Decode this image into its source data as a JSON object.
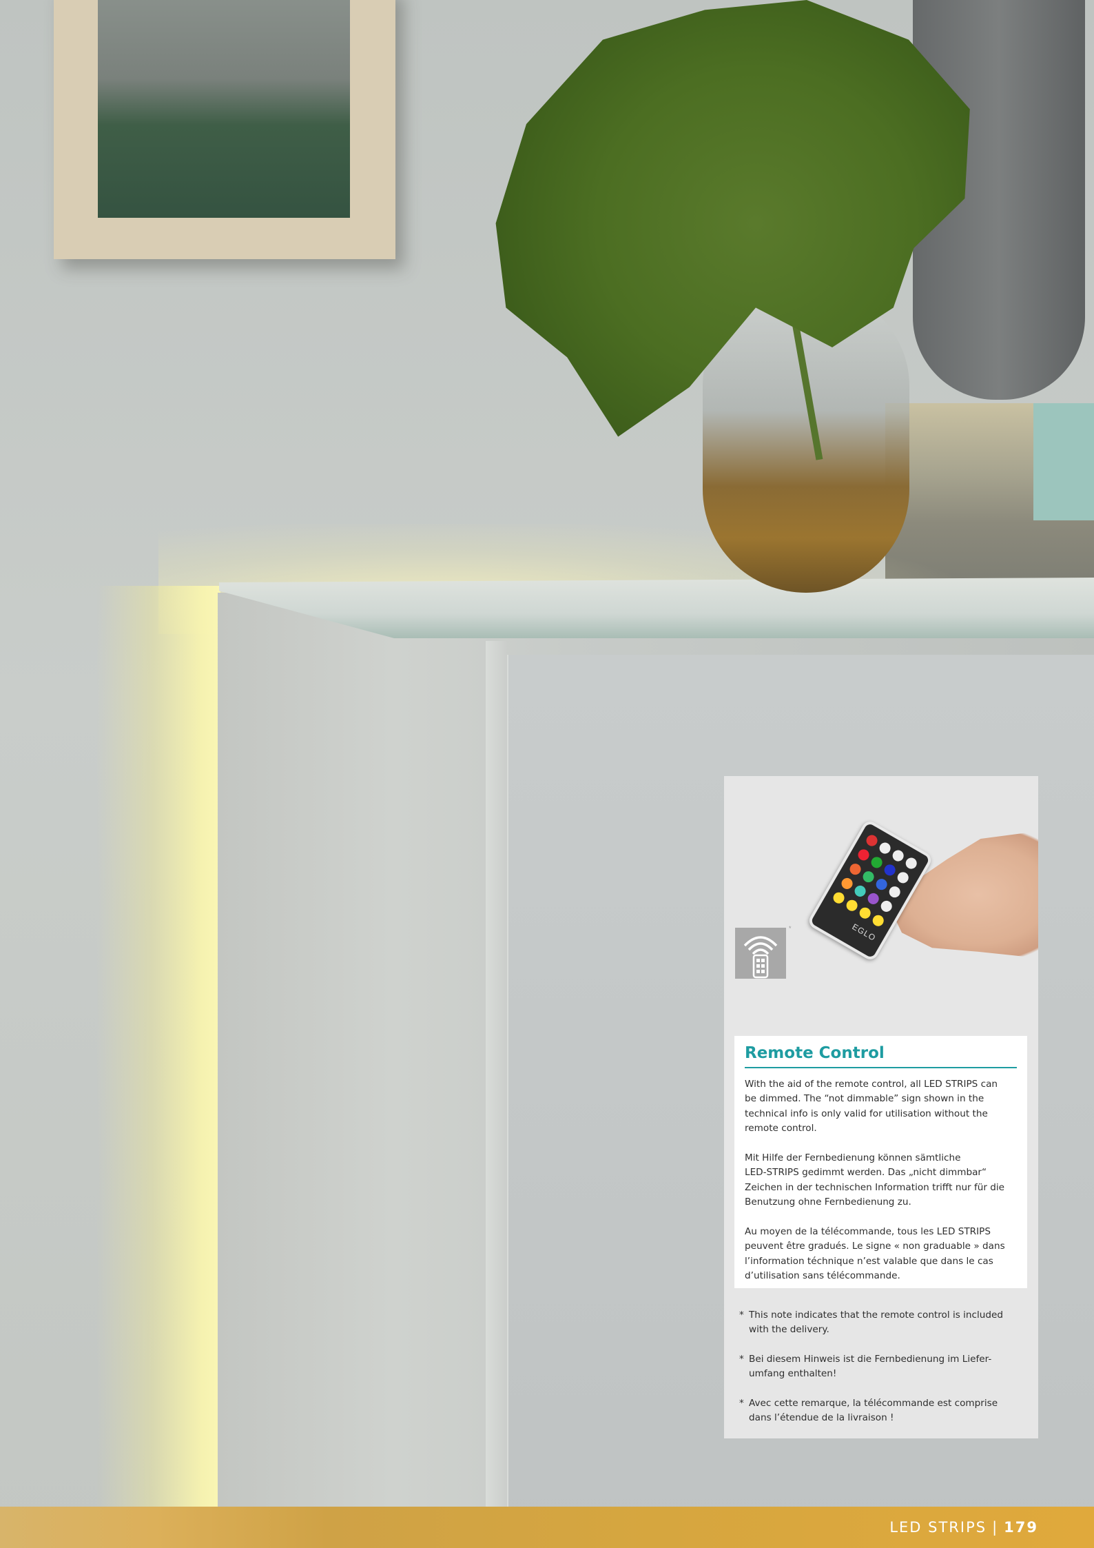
{
  "panel": {
    "title": "Remote Control",
    "paragraphs": [
      "With the aid of the remote control, all LED STRIPS can\nbe dimmed. The “not dimmable” sign shown in the\ntechnical info is only valid for utilisation without the\nremote control.",
      "Mit Hilfe der Fernbedienung können sämtliche\nLED-STRIPS gedimmt werden. Das „nicht dimmbar“\nZeichen in der technischen Information trifft nur für die\nBenutzung ohne Fernbedienung  zu.",
      "Au moyen de la télécommande, tous les LED STRIPS\npeuvent être gradués. Le signe « non graduable » dans\nl’information téchnique n’est valable que dans le cas\nd’utilisation sans télécommande."
    ],
    "notes": [
      "This note indicates that the remote control is included\nwith the delivery.",
      "Bei diesem Hinweis ist die Fernbedienung im Liefer-\numfang enthalten!",
      "Avec cette remarque, la télécommande est comprise\ndans l’étendue de la livraison !"
    ],
    "note_marker": "*",
    "icon_marker": "*",
    "icon": "remote-control-ir-icon",
    "remote_brand": "EGLO"
  },
  "footer": {
    "section": "LED STRIPS",
    "separator": "|",
    "page_number": "179"
  },
  "colors": {
    "accent_teal": "#1e9ca1",
    "footer_gold": "#d6a63f",
    "panel_bg": "#e6e6e6"
  }
}
